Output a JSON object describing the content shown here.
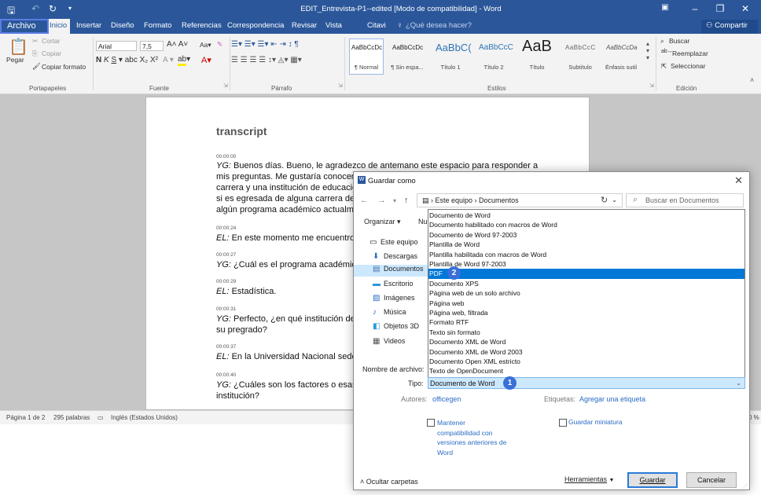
{
  "window": {
    "title": "EDIT_Entrevista-P1--edited [Modo de compatibilidad] - Word"
  },
  "tabs": {
    "archivo": "Archivo",
    "inicio": "Inicio",
    "insertar": "Insertar",
    "diseno": "Diseño",
    "formato": "Formato",
    "referencias": "Referencias",
    "correspondencia": "Correspondencia",
    "revisar": "Revisar",
    "vista": "Vista",
    "citavi": "Citavi",
    "tellme": "¿Qué desea hacer?",
    "share": "Compartir"
  },
  "ribbon": {
    "paste": "Pegar",
    "cut": "Cortar",
    "copy": "Copiar",
    "format_painter": "Copiar formato",
    "font_name": "Arial",
    "font_size": "7,5",
    "styles": [
      {
        "sample": "AaBbCcDc",
        "name": "¶ Normal"
      },
      {
        "sample": "AaBbCcDc",
        "name": "¶ Sin espa..."
      },
      {
        "sample": "AaBbC(",
        "name": "Título 1"
      },
      {
        "sample": "AaBbCcC",
        "name": "Título 2"
      },
      {
        "sample": "AaB",
        "name": "Título"
      },
      {
        "sample": "AaBbCcC",
        "name": "Subtítulo"
      },
      {
        "sample": "AaBbCcDa",
        "name": "Énfasis sutil"
      }
    ],
    "find": "Buscar",
    "replace": "Reemplazar",
    "select": "Seleccionar",
    "groups": {
      "clipboard": "Portapapeles",
      "font": "Fuente",
      "paragraph": "Párrafo",
      "styles": "Estilos",
      "editing": "Edición"
    }
  },
  "document": {
    "title": "transcript",
    "entries": [
      {
        "time": "00:00:00",
        "speaker": "YG:",
        "lines": [
          "Buenos días. Bueno, le agradezco de antemano este espacio para responder a",
          "mis preguntas. Me gustaría conocer",
          "carrera y una institución de educació",
          "si es egresada de alguna carrera de",
          "algún programa académico actualm"
        ]
      },
      {
        "time": "00:00:24",
        "speaker": "EL:",
        "lines": [
          "En este momento me encuentro"
        ]
      },
      {
        "time": "00:00:27",
        "speaker": "YG:",
        "lines": [
          "¿Cuál es el programa académic"
        ]
      },
      {
        "time": "00:00:29",
        "speaker": "EL:",
        "lines": [
          "Estadística."
        ]
      },
      {
        "time": "00:00:31",
        "speaker": "YG:",
        "lines": [
          "Perfecto, ¿en qué institución de",
          "su pregrado?"
        ]
      },
      {
        "time": "00:00:37",
        "speaker": "EL:",
        "lines": [
          "En la Universidad Nacional sede"
        ]
      },
      {
        "time": "00:00:40",
        "speaker": "YG:",
        "lines": [
          "¿Cuáles son los factores o esas",
          "institución?"
        ]
      }
    ]
  },
  "statusbar": {
    "page": "Página 1 de 2",
    "words": "295 palabras",
    "language": "Inglés (Estados Unidos)",
    "zoom": "0 %"
  },
  "dialog": {
    "title": "Guardar como",
    "address": "›  Este equipo  ›  Documentos",
    "search_placeholder": "Buscar en Documentos",
    "organize": "Organizar",
    "nav_items": [
      "Este equipo",
      "Descargas",
      "Documentos",
      "Escritorio",
      "Imágenes",
      "Música",
      "Objetos 3D",
      "Videos"
    ],
    "file_types": [
      "Documento de Word",
      "Documento habilitado con macros de Word",
      "Documento de Word 97-2003",
      "Plantilla de Word",
      "Plantilla habilitada con macros de Word",
      "Plantilla de Word 97-2003",
      "PDF",
      "Documento XPS",
      "Página web de un solo archivo",
      "Página web",
      "Página web, filtrada",
      "Formato RTF",
      "Texto sin formato",
      "Documento XML de Word",
      "Documento XML de Word 2003",
      "Documento Open XML estricto",
      "Texto de OpenDocument"
    ],
    "selected_type_index": 6,
    "filename_label": "Nombre de archivo:",
    "type_label": "Tipo:",
    "type_value": "Documento de Word",
    "authors_label": "Autores:",
    "authors_value": "officegen",
    "tags_label": "Etiquetas:",
    "tags_value": "Agregar una etiqueta",
    "keep_compat": "Mantener compatibilidad con versiones anteriores de Word",
    "save_thumbnail": "Guardar miniatura",
    "hide_folders": "Ocultar carpetas",
    "tools": "Herramientas",
    "save": "Guardar",
    "cancel": "Cancelar",
    "badge_type": "1",
    "badge_pdf": "2"
  },
  "colors": {
    "word_blue": "#2b579a",
    "selection_blue": "#0078d7",
    "badge_blue": "#3a6fd8"
  }
}
